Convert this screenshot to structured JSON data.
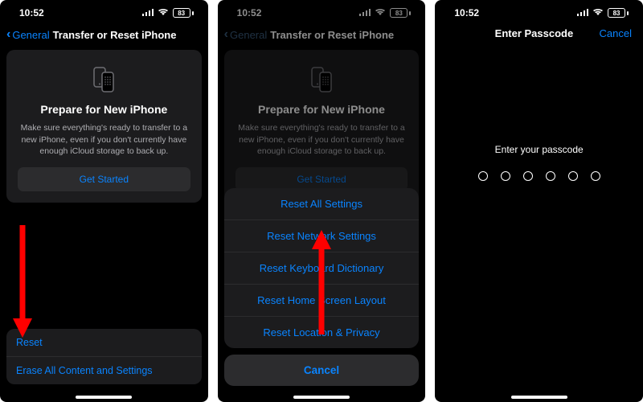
{
  "status": {
    "time": "10:52",
    "battery_pct": "83"
  },
  "nav": {
    "back_label": "General",
    "title": "Transfer or Reset iPhone",
    "passcode_title": "Enter Passcode",
    "cancel": "Cancel"
  },
  "card": {
    "title": "Prepare for New iPhone",
    "body": "Make sure everything's ready to transfer to a new iPhone, even if you don't currently have enough iCloud storage to back up.",
    "cta": "Get Started"
  },
  "bottom_options": {
    "reset": "Reset",
    "erase": "Erase All Content and Settings"
  },
  "action_sheet": {
    "items": [
      "Reset All Settings",
      "Reset Network Settings",
      "Reset Keyboard Dictionary",
      "Reset Home Screen Layout",
      "Reset Location & Privacy"
    ],
    "cancel": "Cancel"
  },
  "passcode": {
    "prompt": "Enter your passcode"
  }
}
